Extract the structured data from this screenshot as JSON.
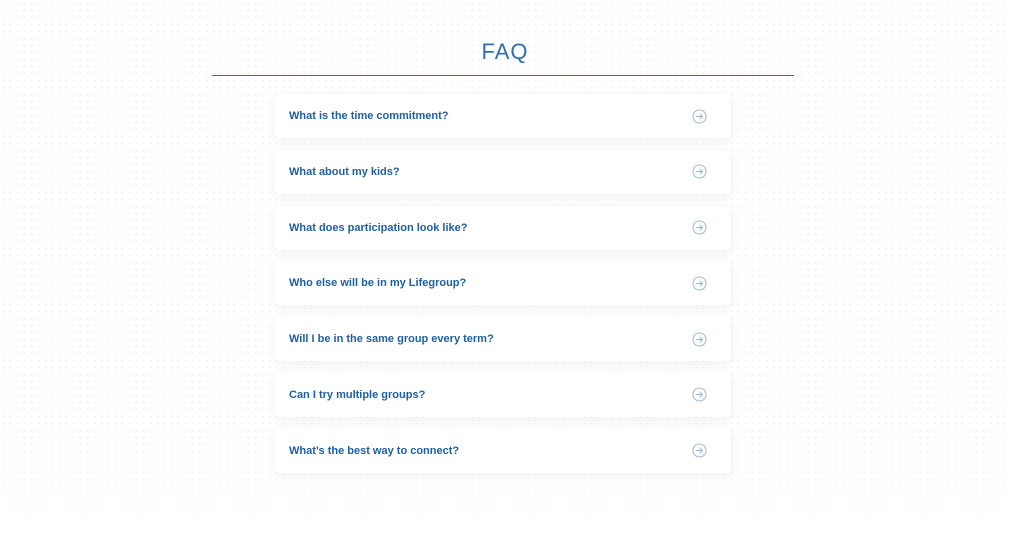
{
  "faq": {
    "title": "FAQ",
    "items": [
      {
        "question": "What is the time commitment?",
        "icon": "arrow-right-circle-icon"
      },
      {
        "question": "What about my kids?",
        "icon": "arrow-right-circle-icon"
      },
      {
        "question": "What does participation look like?",
        "icon": "arrow-right-circle-icon"
      },
      {
        "question": "Who else will be in my Lifegroup?",
        "icon": "arrow-right-circle-icon"
      },
      {
        "question": "Will I be in the same group every term?",
        "icon": "arrow-right-circle-icon"
      },
      {
        "question": "Can I try multiple groups?",
        "icon": "arrow-right-circle-icon"
      },
      {
        "question": "What’s the best way to connect?",
        "icon": "arrow-right-circle-icon"
      }
    ]
  },
  "colors": {
    "accent": "#2f6fb0",
    "question_text": "#1f5f9e",
    "icon_stroke": "#9bb6d0",
    "card_background": "#ffffff"
  }
}
